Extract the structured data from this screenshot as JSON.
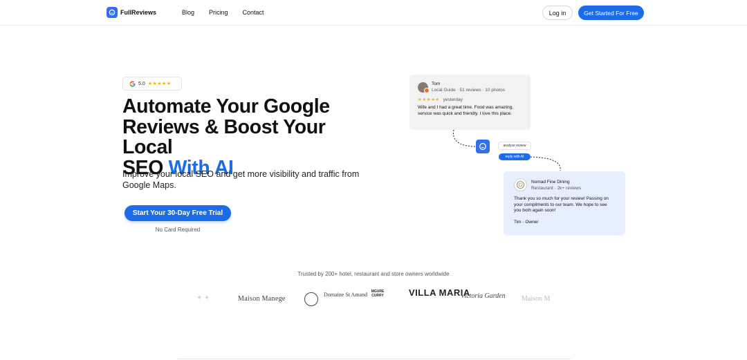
{
  "header": {
    "logo_text": "FullReviews",
    "nav": [
      "Blog",
      "Pricing",
      "Contact"
    ],
    "login_label": "Log in",
    "cta_label": "Get Started For Free"
  },
  "hero": {
    "rating_value": "5.0",
    "rating_stars": "★★★★★",
    "title_line1": "Automate Your Google",
    "title_line2": "Reviews & Boost Your Local",
    "title_line3_start": "SEO ",
    "title_line3_accent": "With AI",
    "subtitle": "Improve your local SEO and get more visibility and traffic from Google Maps.",
    "trial_button": "Start Your 30-Day Free Trial",
    "no_card": "No Card Required"
  },
  "review": {
    "name": "Tom",
    "meta": "Local Guide · 51 reviews · 10 photos",
    "stars": "★★★★★",
    "when": "yesterday",
    "text": "Wife and I had a great time. Food was amazing, service was quick and friendly. I love this place."
  },
  "flow": {
    "analyze_label": "analyze review",
    "reply_label": "reply with AI"
  },
  "reply": {
    "name": "Nomad Fine Dining",
    "meta": "Restaurant · 2k+ reviews",
    "text": "Thank you so much for your review! Passing on your compliments to our team. We hope to see you both again soon!",
    "signature": "Tim - Owner"
  },
  "trusted": {
    "caption": "Trusted by 200+ hotel, restaurant and store owners worldwide",
    "brands": [
      "Maison Manege",
      "Domaine St Amand",
      "MGURE CURRY",
      "VILLA MARIA",
      "Victoria Garden",
      "Maison M"
    ]
  },
  "colors": {
    "accent": "#1c6ce8",
    "star": "#f5b301",
    "reply_bg": "#e6efff",
    "review_bg": "#f2f2f2"
  }
}
